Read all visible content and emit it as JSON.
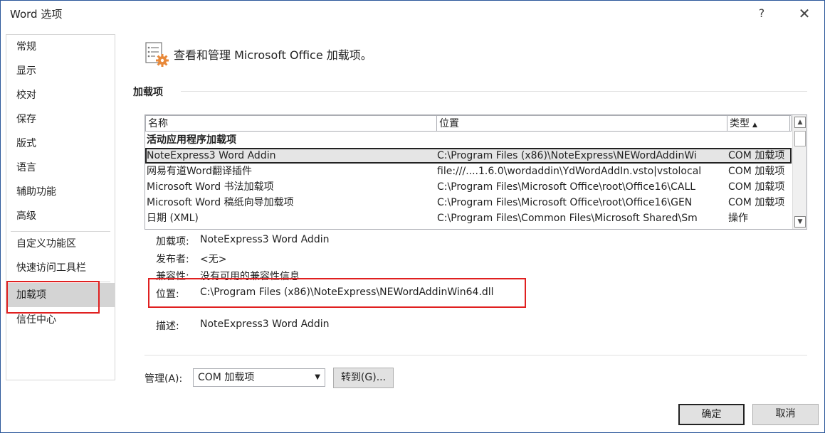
{
  "window": {
    "title": "Word 选项",
    "help": "?",
    "close": "✕"
  },
  "nav": {
    "items": [
      {
        "label": "常规"
      },
      {
        "label": "显示"
      },
      {
        "label": "校对"
      },
      {
        "label": "保存"
      },
      {
        "label": "版式"
      },
      {
        "label": "语言"
      },
      {
        "label": "辅助功能"
      },
      {
        "label": "高级"
      },
      {
        "label": "自定义功能区"
      },
      {
        "label": "快速访问工具栏"
      },
      {
        "label": "加载项"
      },
      {
        "label": "信任中心"
      }
    ],
    "active": "加载项"
  },
  "header": {
    "text": "查看和管理 Microsoft Office 加载项。"
  },
  "section": {
    "title": "加载项"
  },
  "grid": {
    "columns": [
      "名称",
      "位置",
      "类型"
    ],
    "sort_indicator": "▲",
    "group": "活动应用程序加载项",
    "rows": [
      {
        "name": "NoteExpress3 Word Addin",
        "location": "C:\\Program Files (x86)\\NoteExpress\\NEWordAddinWi",
        "type": "COM 加载项",
        "selected": true
      },
      {
        "name": "网易有道Word翻译插件",
        "location": "file:///....1.6.0\\wordaddin\\YdWordAddIn.vsto|vstolocal",
        "type": "COM 加载项"
      },
      {
        "name": "Microsoft Word 书法加载项",
        "location": "C:\\Program Files\\Microsoft Office\\root\\Office16\\CALL",
        "type": "COM 加载项"
      },
      {
        "name": "Microsoft Word 稿纸向导加载项",
        "location": "C:\\Program Files\\Microsoft Office\\root\\Office16\\GEN",
        "type": "COM 加载项"
      },
      {
        "name": "日期 (XML)",
        "location": "C:\\Program Files\\Common Files\\Microsoft Shared\\Sm",
        "type": "操作"
      }
    ]
  },
  "details": {
    "addin_label": "加载项:",
    "addin_value": "NoteExpress3 Word Addin",
    "publisher_label": "发布者:",
    "publisher_value": "<无>",
    "compat_label": "兼容性:",
    "compat_value": "没有可用的兼容性信息",
    "location_label": "位置:",
    "location_value": "C:\\Program Files (x86)\\NoteExpress\\NEWordAddinWin64.dll",
    "desc_label": "描述:",
    "desc_value": "NoteExpress3 Word Addin"
  },
  "manage": {
    "label": "管理(A):",
    "selected": "COM 加载项",
    "goto": "转到(G)..."
  },
  "footer": {
    "ok": "确定",
    "cancel": "取消"
  },
  "colors": {
    "highlight": "#e02020",
    "active_nav": "#d4d4d4",
    "icon_orange": "#e8893a"
  }
}
